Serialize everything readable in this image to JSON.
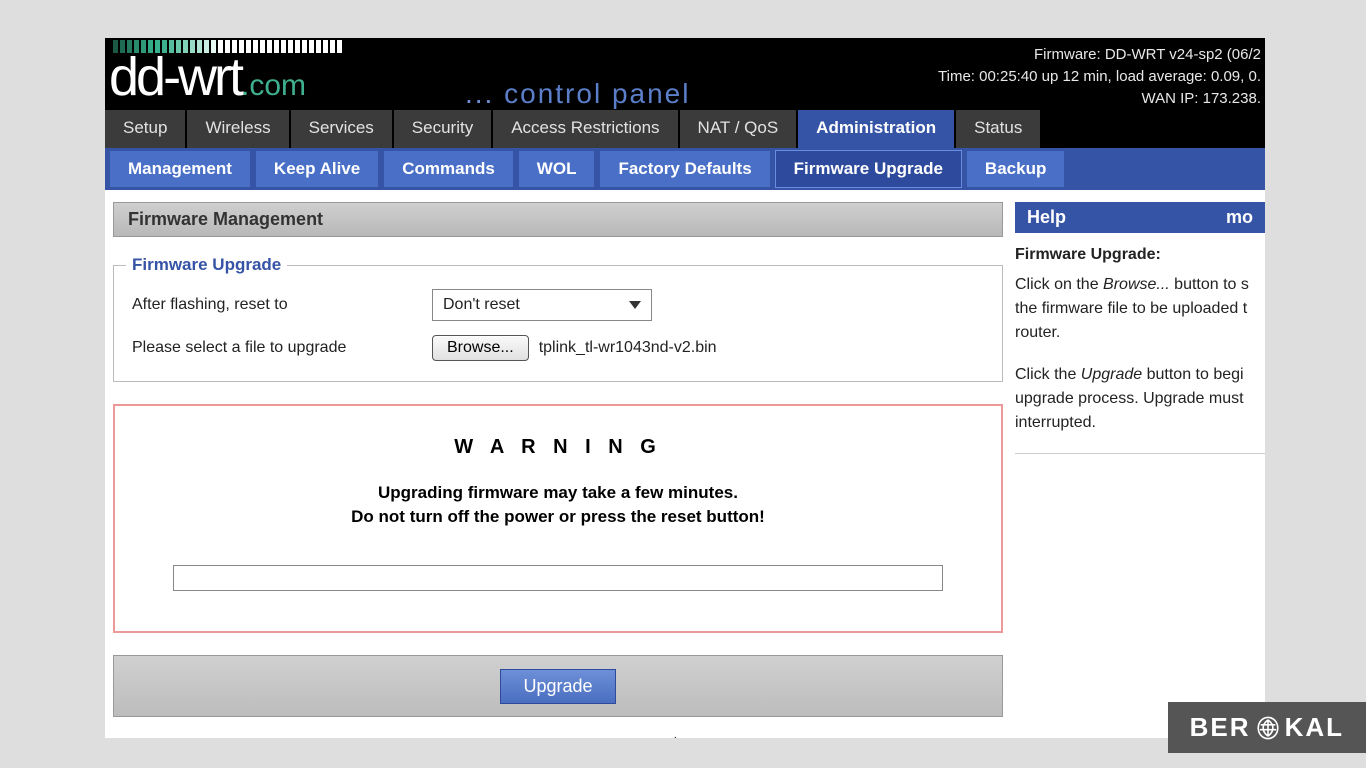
{
  "header": {
    "logo_main": "dd-wrt",
    "logo_suffix": ".com",
    "control_panel_prefix": "...",
    "control_panel_text": "control panel",
    "firmware_line": "Firmware: DD-WRT v24-sp2 (06/2",
    "time_line": "Time: 00:25:40 up 12 min, load average: 0.09, 0.",
    "wan_line": "WAN IP: 173.238."
  },
  "maintabs": [
    {
      "label": "Setup",
      "active": false
    },
    {
      "label": "Wireless",
      "active": false
    },
    {
      "label": "Services",
      "active": false
    },
    {
      "label": "Security",
      "active": false
    },
    {
      "label": "Access Restrictions",
      "active": false
    },
    {
      "label": "NAT / QoS",
      "active": false
    },
    {
      "label": "Administration",
      "active": true
    },
    {
      "label": "Status",
      "active": false
    }
  ],
  "subtabs": [
    {
      "label": "Management",
      "active": false
    },
    {
      "label": "Keep Alive",
      "active": false
    },
    {
      "label": "Commands",
      "active": false
    },
    {
      "label": "WOL",
      "active": false
    },
    {
      "label": "Factory Defaults",
      "active": false
    },
    {
      "label": "Firmware Upgrade",
      "active": true
    },
    {
      "label": "Backup",
      "active": false
    }
  ],
  "main": {
    "section_title": "Firmware Management",
    "fieldset_title": "Firmware Upgrade",
    "row1_label": "After flashing, reset to",
    "row1_value": "Don't reset",
    "row2_label": "Please select a file to upgrade",
    "browse_label": "Browse...",
    "filename": "tplink_tl-wr1043nd-v2.bin",
    "warning_title": "W A R N I N G",
    "warning_line1": "Upgrading firmware may take a few minutes.",
    "warning_line2": "Do not turn off the power or press the reset button!",
    "upgrade_label": "Upgrade"
  },
  "help": {
    "bar_title": "Help",
    "bar_more": "mo",
    "heading": "Firmware Upgrade:",
    "para1_pre": "Click on the ",
    "para1_em": "Browse...",
    "para1_post": " button to s the firmware file to be uploaded t router.",
    "para2_pre": "Click the ",
    "para2_em": "Upgrade",
    "para2_post": " button to begi upgrade process. Upgrade must interrupted."
  },
  "watermark": "BER   KAL",
  "colors": {
    "accent": "#3654a6",
    "tick_green": "#3fb08f"
  }
}
